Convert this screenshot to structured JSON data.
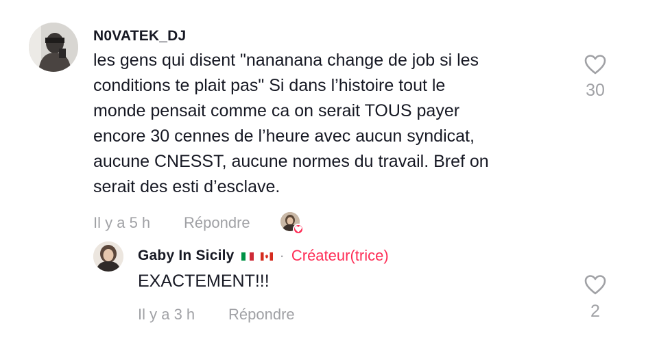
{
  "comment": {
    "username": "N0VATEK_DJ",
    "text": "les gens qui disent \"nananana change de job si les\nconditions te plait pas\" Si dans l’histoire tout le\nmonde pensait comme ca on serait TOUS payer\nencore 30 cennes de l’heure avec aucun syndicat,\naucune CNESST, aucune normes du travail. Bref on\nserait des esti d’esclave.",
    "time": "Il y a 5 h",
    "reply_label": "Répondre",
    "like_count": "30",
    "like_icon": "heart-outline-icon",
    "creator_liked_icon": "heart-filled-icon"
  },
  "reply": {
    "username": "Gaby In Sicily",
    "flags": [
      "italy-flag",
      "canada-flag"
    ],
    "separator": "·",
    "badge": "Créateur(trice)",
    "text": "EXACTEMENT!!!",
    "time": "Il y a 3 h",
    "reply_label": "Répondre",
    "like_count": "2",
    "like_icon": "heart-outline-icon"
  },
  "colors": {
    "accent": "#fe2c55",
    "muted": "#a0a1a5",
    "text": "#161823"
  }
}
